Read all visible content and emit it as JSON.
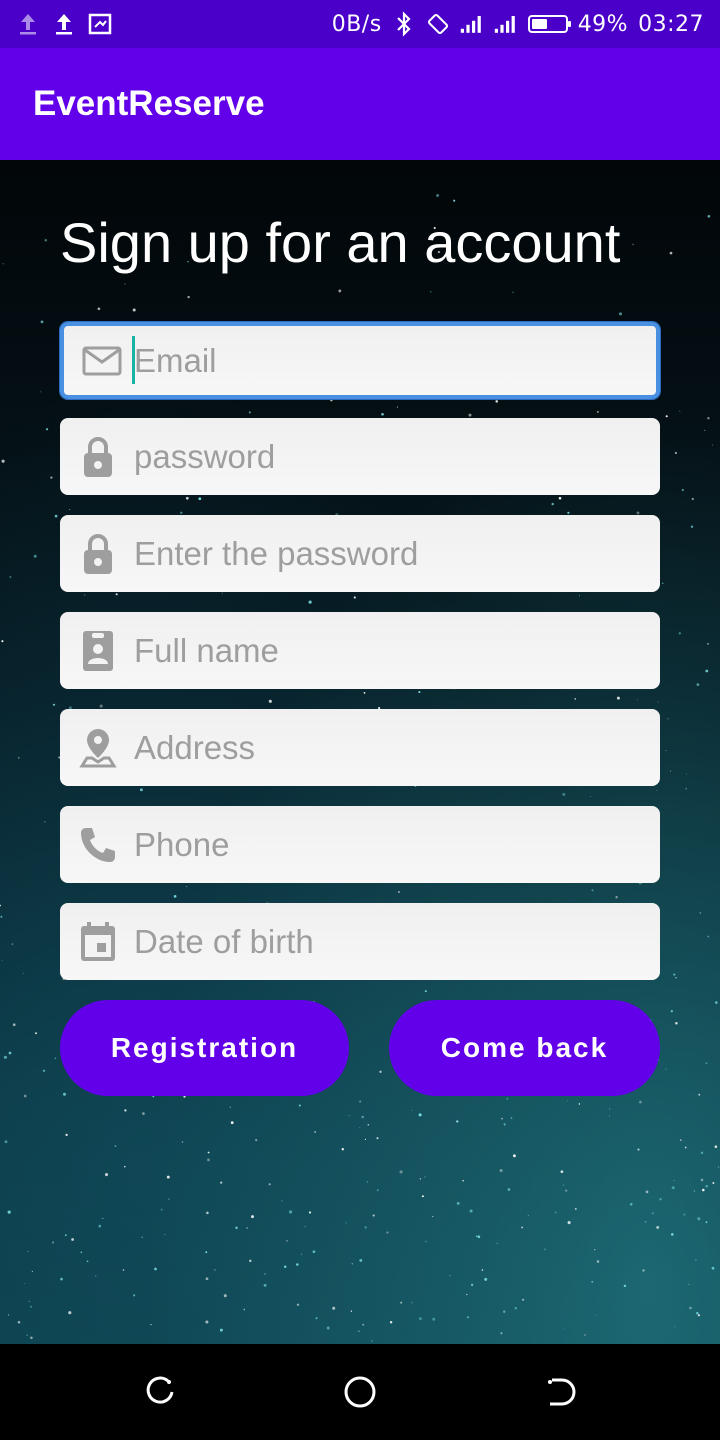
{
  "status_bar": {
    "net_speed": "0B/s",
    "battery_percent": "49%",
    "battery_level": 0.49,
    "time": "03:27",
    "icons": [
      "upload-icon",
      "upload-icon",
      "screenshot-icon",
      "bluetooth-icon",
      "rotate-icon",
      "signal-icon",
      "signal-icon",
      "battery-icon"
    ]
  },
  "app_bar": {
    "title": "EventReserve"
  },
  "form": {
    "title": "Sign up for an account",
    "fields": [
      {
        "icon": "email-icon",
        "placeholder": "Email",
        "value": "",
        "focused": true
      },
      {
        "icon": "lock-icon",
        "placeholder": "password",
        "value": ""
      },
      {
        "icon": "lock-icon",
        "placeholder": "Enter the password",
        "value": ""
      },
      {
        "icon": "id-badge-icon",
        "placeholder": "Full name",
        "value": ""
      },
      {
        "icon": "location-icon",
        "placeholder": "Address",
        "value": ""
      },
      {
        "icon": "phone-icon",
        "placeholder": "Phone",
        "value": ""
      },
      {
        "icon": "calendar-icon",
        "placeholder": "Date of birth",
        "value": ""
      }
    ],
    "register_label": "Registration",
    "back_label": "Come back"
  },
  "colors": {
    "primary": "#6200ea",
    "status_bar": "#4a00c9",
    "focus": "#4a90e2",
    "caret": "#19b3a5"
  },
  "nav_bar": {
    "icons": [
      "recents-icon",
      "home-icon",
      "back-icon"
    ]
  }
}
